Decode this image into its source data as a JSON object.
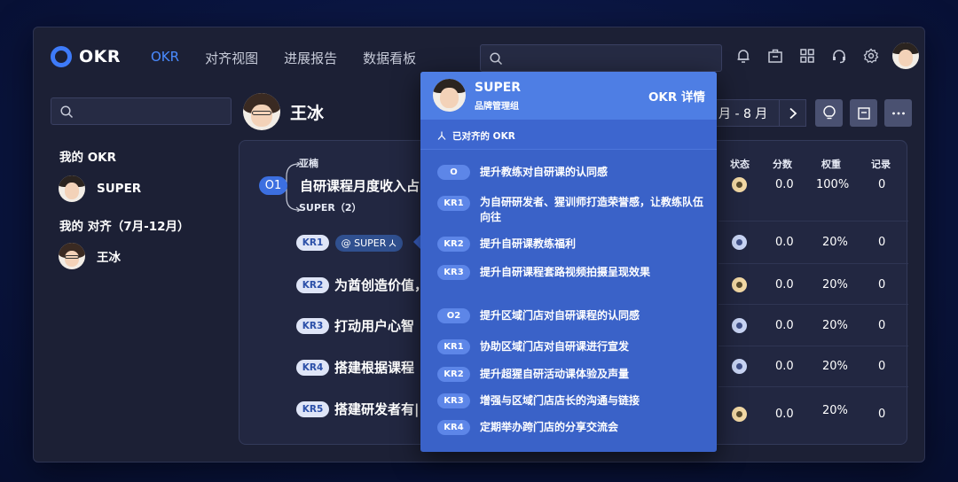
{
  "app": {
    "logo_text": "OKR"
  },
  "nav": [
    "OKR",
    "对齐视图",
    "进展报告",
    "数据看板"
  ],
  "sidebar": {
    "my_okr_title": "我的 OKR",
    "my_okr_user": "SUPER",
    "aligned_title": "我的 对齐（7月-12月）",
    "aligned_user": "王冰"
  },
  "header": {
    "user_name": "王冰",
    "date_range": "月 - 8 月"
  },
  "objective": {
    "badge": "O1",
    "aligned_above": "亚楠",
    "title": "自研课程月度收入占",
    "aligned_below": "SUPER（2）"
  },
  "columns": [
    "状态",
    "分数",
    "权重",
    "记录"
  ],
  "o1_row": {
    "status": "yellow",
    "score": "0.0",
    "weight": "100%",
    "records": "0"
  },
  "krs": [
    {
      "tag": "KR1",
      "text": "",
      "mention": "@ SUPER",
      "status": "blue",
      "score": "0.0",
      "weight": "20%",
      "records": "0"
    },
    {
      "tag": "KR2",
      "text": "为酋创造价值，",
      "status": "yellow",
      "score": "0.0",
      "weight": "20%",
      "records": "0"
    },
    {
      "tag": "KR3",
      "text": "打动用户心智",
      "status": "blue",
      "score": "0.0",
      "weight": "20%",
      "records": "0"
    },
    {
      "tag": "KR4",
      "text": "搭建根据课程",
      "status": "blue",
      "score": "0.0",
      "weight": "20%",
      "records": "0"
    },
    {
      "tag": "KR5",
      "text": "搭建研发者有|",
      "status": "yellow",
      "score": "0.0",
      "weight": "20%",
      "records": "0"
    }
  ],
  "popup": {
    "name": "SUPER",
    "team": "品牌管理组",
    "detail_link": "OKR 详情",
    "aligned_label": "已对齐的 OKR",
    "items": [
      {
        "tag": "O",
        "text": "提升教练对自研课的认同感"
      },
      {
        "tag": "KR1",
        "text": "为自研研发者、猩训师打造荣誉感，让教练队伍向往"
      },
      {
        "tag": "KR2",
        "text": "提升自研课教练福利"
      },
      {
        "tag": "KR3",
        "text": "提升自研课程套路视频拍摄呈现效果"
      },
      {
        "tag": "O2",
        "text": "提升区域门店对自研课程的认同感"
      },
      {
        "tag": "KR1",
        "text": "协助区域门店对自研课进行宣发"
      },
      {
        "tag": "KR2",
        "text": "提升超猩自研活动课体验及声量"
      },
      {
        "tag": "KR3",
        "text": "增强与区域门店店长的沟通与链接"
      },
      {
        "tag": "KR4",
        "text": "定期举办跨门店的分享交流会"
      }
    ]
  },
  "colors": {
    "accent": "#3e7bfa",
    "popup": "#3a62c8",
    "status_yellow": "#f3d9a5",
    "status_blue": "#c9d5f5"
  },
  "icons": [
    "search-icon",
    "bell-icon",
    "briefcase-icon",
    "grid-icon",
    "headset-icon",
    "gear-icon",
    "chevron-right-icon",
    "bulb-icon",
    "note-icon",
    "more-icon",
    "align-icon"
  ]
}
